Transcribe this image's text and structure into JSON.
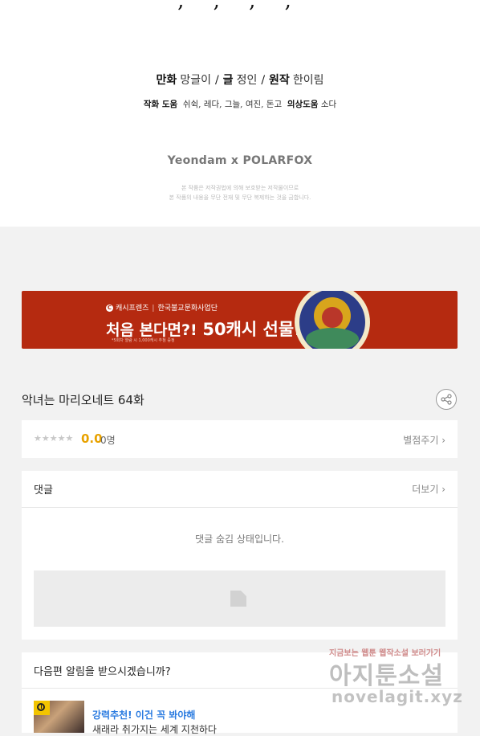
{
  "credits": {
    "top_glyphs": ", , , ,",
    "main": {
      "comic_label": "만화",
      "comic_name": "망글이",
      "story_label": "글",
      "story_name": "정인",
      "original_label": "원작",
      "original_name": "한이림",
      "separator": "/"
    },
    "assist": {
      "label": "작화 도움",
      "names": "쉬쉭, 레다, 그늘, 여진, 돈고",
      "costume_label": "의상도움",
      "costume_name": "소다"
    },
    "logo": "Yeondam x POLARFOX",
    "copyright_line1": "본 작품은 저작권법에 의해 보호받는 저작물이므로",
    "copyright_line2": "본 작품의 내용을 무단 전재 및 무단 복제하는 것을 금합니다."
  },
  "banner": {
    "brand": "캐시프렌즈",
    "partner": "한국불교문화사업단",
    "headline_prefix": "처음 본다면?!",
    "headline_main": "50캐시 선물!!",
    "note": "*5회차 열람 시 1,000캐시 추첨 증정",
    "bg_color": "#b52a10"
  },
  "episode": {
    "title": "악녀는 마리오네트 64화",
    "share_icon": "share-icon"
  },
  "rating": {
    "stars": "★★★★★",
    "score": "0.0",
    "count": "0명",
    "rate_label": "별점주기 ›"
  },
  "comments": {
    "title": "댓글",
    "more_label": "더보기 ›",
    "hidden_message": "댓글 숨김 상태입니다."
  },
  "notify": {
    "question": "다음편 알림을 받으시겠습니까?",
    "rec_label": "강력추천! 이건 꼭 봐야해",
    "rec_desc": "새래라 취가지는 세계 지천하다"
  },
  "watermark": {
    "top_text": "지금보는 웹툰 웹작소설 보러가기",
    "big_text": "아지툰소설",
    "url": "novelagit.xyz"
  }
}
